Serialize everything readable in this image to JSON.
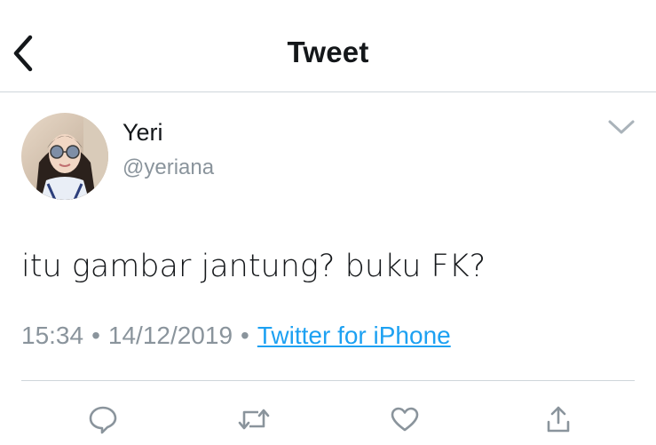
{
  "header": {
    "title": "Tweet",
    "back_icon": "chevron-left-icon"
  },
  "author": {
    "name": "Yeri",
    "handle": "@yeriana",
    "avatar_icon": "avatar-photo"
  },
  "tweet": {
    "text": "itu gambar jantung? buku FK?",
    "time": "15:34",
    "date": "14/12/2019",
    "separator": "•",
    "source": "Twitter for iPhone"
  },
  "actions": [
    {
      "icon": "reply-icon"
    },
    {
      "icon": "retweet-icon"
    },
    {
      "icon": "like-icon"
    },
    {
      "icon": "share-icon"
    }
  ],
  "colors": {
    "text": "#14171a",
    "secondary": "#8a949c",
    "link": "#1da1f2",
    "divider": "#cfd5da"
  }
}
